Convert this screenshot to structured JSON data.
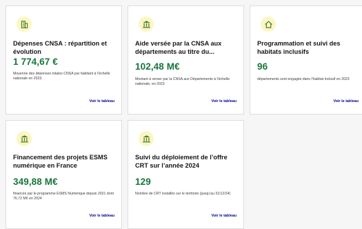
{
  "cards": [
    {
      "icon": "building-icon",
      "title": "Dépenses CNSA : répartition et évolution",
      "value": "1 774,67 €",
      "description": "Moyenne des dépenses totales CNSA par habitant à l'échelle nationale en 2023.",
      "link": "Voir le tableau"
    },
    {
      "icon": "bank-icon",
      "title": "Aide versée par la CNSA aux départements au titre du...",
      "value": "102,48 M€",
      "description": "Montant à verser par la CNSA aux Départements à l'échelle nationale, en 2023",
      "link": "Voir le tableau"
    },
    {
      "icon": "home-icon",
      "title": "Programmation et suivi des habitats inclusifs",
      "value": "96",
      "description": "départements sont engagés dans l'habitat inclusif en 2023",
      "link": "Voir le tableau"
    },
    {
      "icon": "bank-icon",
      "title": "Financement des projets ESMS numérique en France",
      "value": "349,88 M€",
      "description": "financés par le programme ESMS Numérique depuis 2021 dont 76,72 M€ en 2024",
      "link": "Voir le tableau"
    },
    {
      "icon": "bank-icon",
      "title": "Suivi du déploiement de l’offre CRT sur l’année 2024",
      "value": "129",
      "description": "Nombre de CRT installés sur le territoire (jusqu’au 31/12/24)",
      "link": "Voir le tableau"
    }
  ],
  "colors": {
    "accent_green": "#18753c",
    "link_blue": "#000091",
    "icon_bg": "#fbf6c4",
    "icon_fg": "#4a7d2c"
  }
}
